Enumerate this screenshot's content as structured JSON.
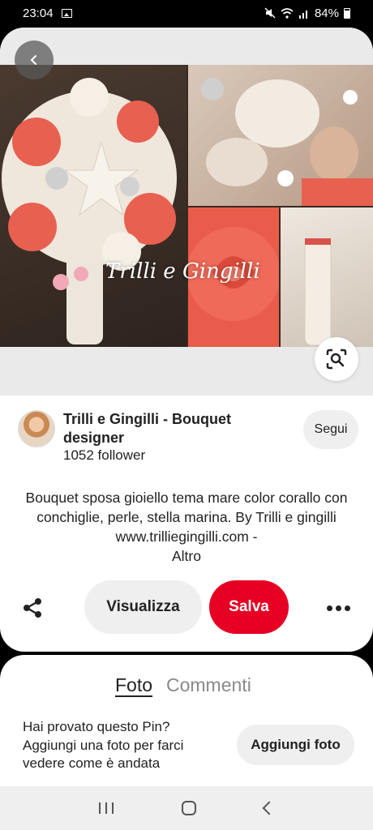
{
  "status_bar": {
    "time": "23:04",
    "battery": "84%",
    "icons": [
      "image-icon",
      "mute-icon",
      "wifi-icon",
      "signal-icon",
      "battery-icon"
    ]
  },
  "pin": {
    "image_watermark": "Trilli e Gingilli",
    "back_icon": "chevron-left-icon",
    "lens_icon": "visual-search-icon"
  },
  "creator": {
    "name": "Trilli e Gingilli - Bouquet designer",
    "followers": "1052 follower",
    "follow_label": "Segui"
  },
  "description": {
    "text": "Bouquet sposa gioiello tema mare color corallo con conchiglie, perle, stella marina. By Trilli e gingilli www.trilliegingilli.com -",
    "more": "Altro"
  },
  "actions": {
    "visualize_label": "Visualizza",
    "save_label": "Salva",
    "share_icon": "share-icon",
    "more_icon": "more-icon"
  },
  "comments_card": {
    "tab_photo": "Foto",
    "tab_comments": "Commenti",
    "tried_text": "Hai provato questo Pin? Aggiungi una foto per farci vedere come è andata",
    "add_photo_label": "Aggiungi foto"
  },
  "colors": {
    "accent": "#e60023",
    "coral": "#e95c4b"
  }
}
